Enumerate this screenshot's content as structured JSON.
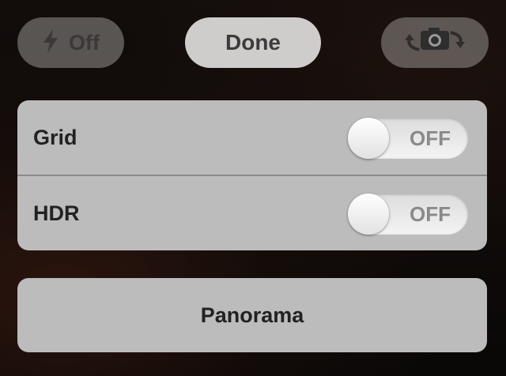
{
  "top_bar": {
    "flash": {
      "label": "Off",
      "icon": "lightning-bolt-icon"
    },
    "done_label": "Done",
    "switch_camera": {
      "icon": "camera-switch-icon"
    }
  },
  "settings": {
    "grid": {
      "label": "Grid",
      "state": "OFF"
    },
    "hdr": {
      "label": "HDR",
      "state": "OFF"
    }
  },
  "panorama": {
    "label": "Panorama"
  },
  "colors": {
    "panel": "#bdbcbc",
    "done_button": "#cfcdcc",
    "toggle_off_text": "#8a8a8a"
  }
}
